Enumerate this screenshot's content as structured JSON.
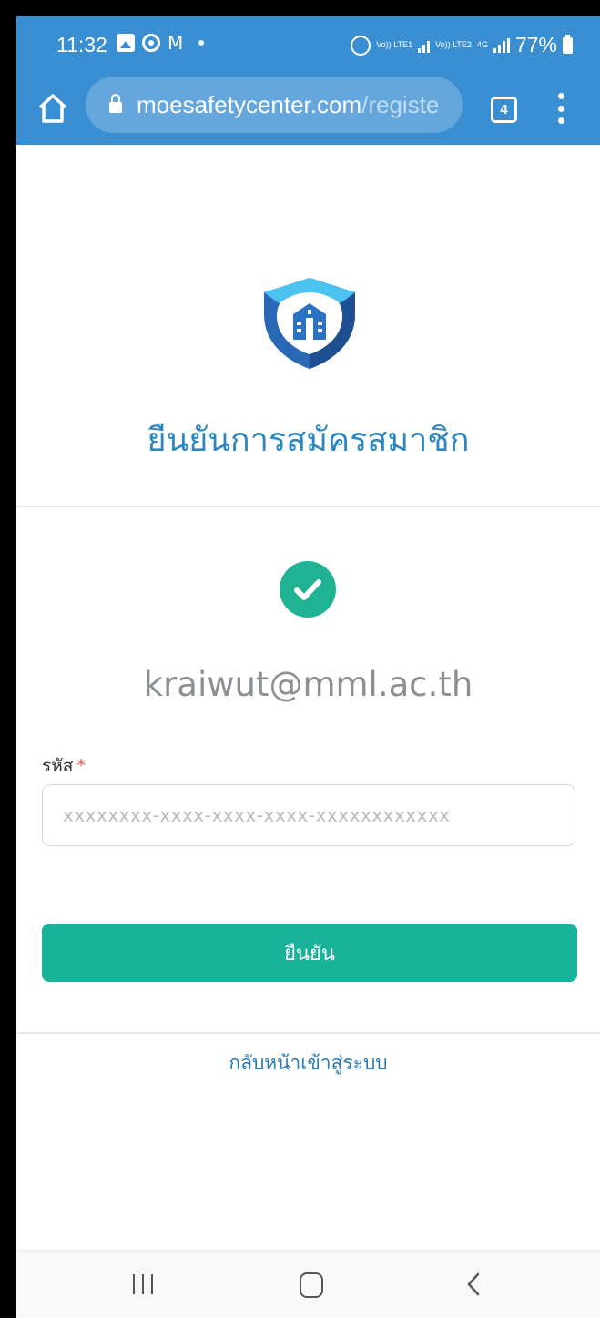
{
  "status_bar": {
    "time": "11:32",
    "icons": [
      "photo-icon",
      "chrome-icon",
      "gmail-icon",
      "notification-dot"
    ],
    "network_1": "Vo)) LTE1",
    "network_2": "Vo)) LTE2",
    "network_type": "4G",
    "battery": "77%"
  },
  "browser": {
    "url_host": "moesafetycenter.com",
    "url_path": "/registe",
    "tab_count": "4"
  },
  "page": {
    "title": "ยืนยันการสมัครสมาชิก",
    "email": "kraiwut@mml.ac.th",
    "code_label": "รหัส",
    "required_mark": "*",
    "code_placeholder": "xxxxxxxx-xxxx-xxxx-xxxx-xxxxxxxxxxxx",
    "code_value": "",
    "confirm_button": "ยืนยัน",
    "back_link": "กลับหน้าเข้าสู่ระบบ"
  },
  "colors": {
    "header_blue": "#3a8fd3",
    "title_blue": "#2e86c1",
    "accent_green": "#18b39a",
    "success_green": "#1fb393",
    "link_blue": "#2a7ab8"
  }
}
